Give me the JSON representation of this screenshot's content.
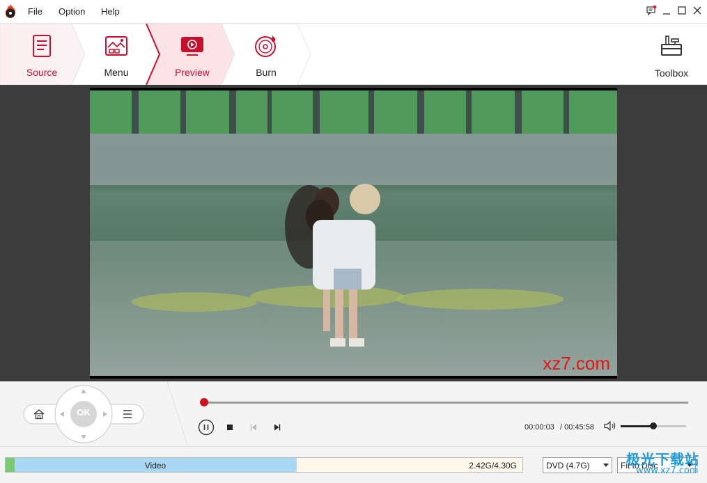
{
  "menubar": {
    "items": [
      "File",
      "Option",
      "Help"
    ]
  },
  "steps": [
    {
      "label": "Source",
      "icon": "source-document-icon"
    },
    {
      "label": "Menu",
      "icon": "menu-template-icon"
    },
    {
      "label": "Preview",
      "icon": "preview-play-icon",
      "active": true
    },
    {
      "label": "Burn",
      "icon": "burn-disc-icon"
    }
  ],
  "toolbox": {
    "label": "Toolbox",
    "icon": "toolbox-icon"
  },
  "video": {
    "watermark": "xz7.com"
  },
  "remote": {
    "ok_label": "OK",
    "home_icon": "home-icon",
    "menu_icon": "list-menu-icon"
  },
  "playback": {
    "progress_fraction": 0.001,
    "current_time": "00:00:03",
    "total_time": "/ 00:45:58",
    "volume_fraction": 0.5
  },
  "status": {
    "video_label": "Video",
    "size_text": "2.42G/4.30G",
    "used_fraction": 0.563,
    "disc_type": "DVD (4.7G)",
    "fit_mode": "Fit to Disc"
  },
  "site_logo": {
    "cn": "极光下载站",
    "en": "www.xz7.com"
  },
  "colors": {
    "accent": "#c8102e",
    "video_fill": "#a9d8f5",
    "free_fill": "#fdf8ea",
    "menu_fill": "#7bc879"
  }
}
